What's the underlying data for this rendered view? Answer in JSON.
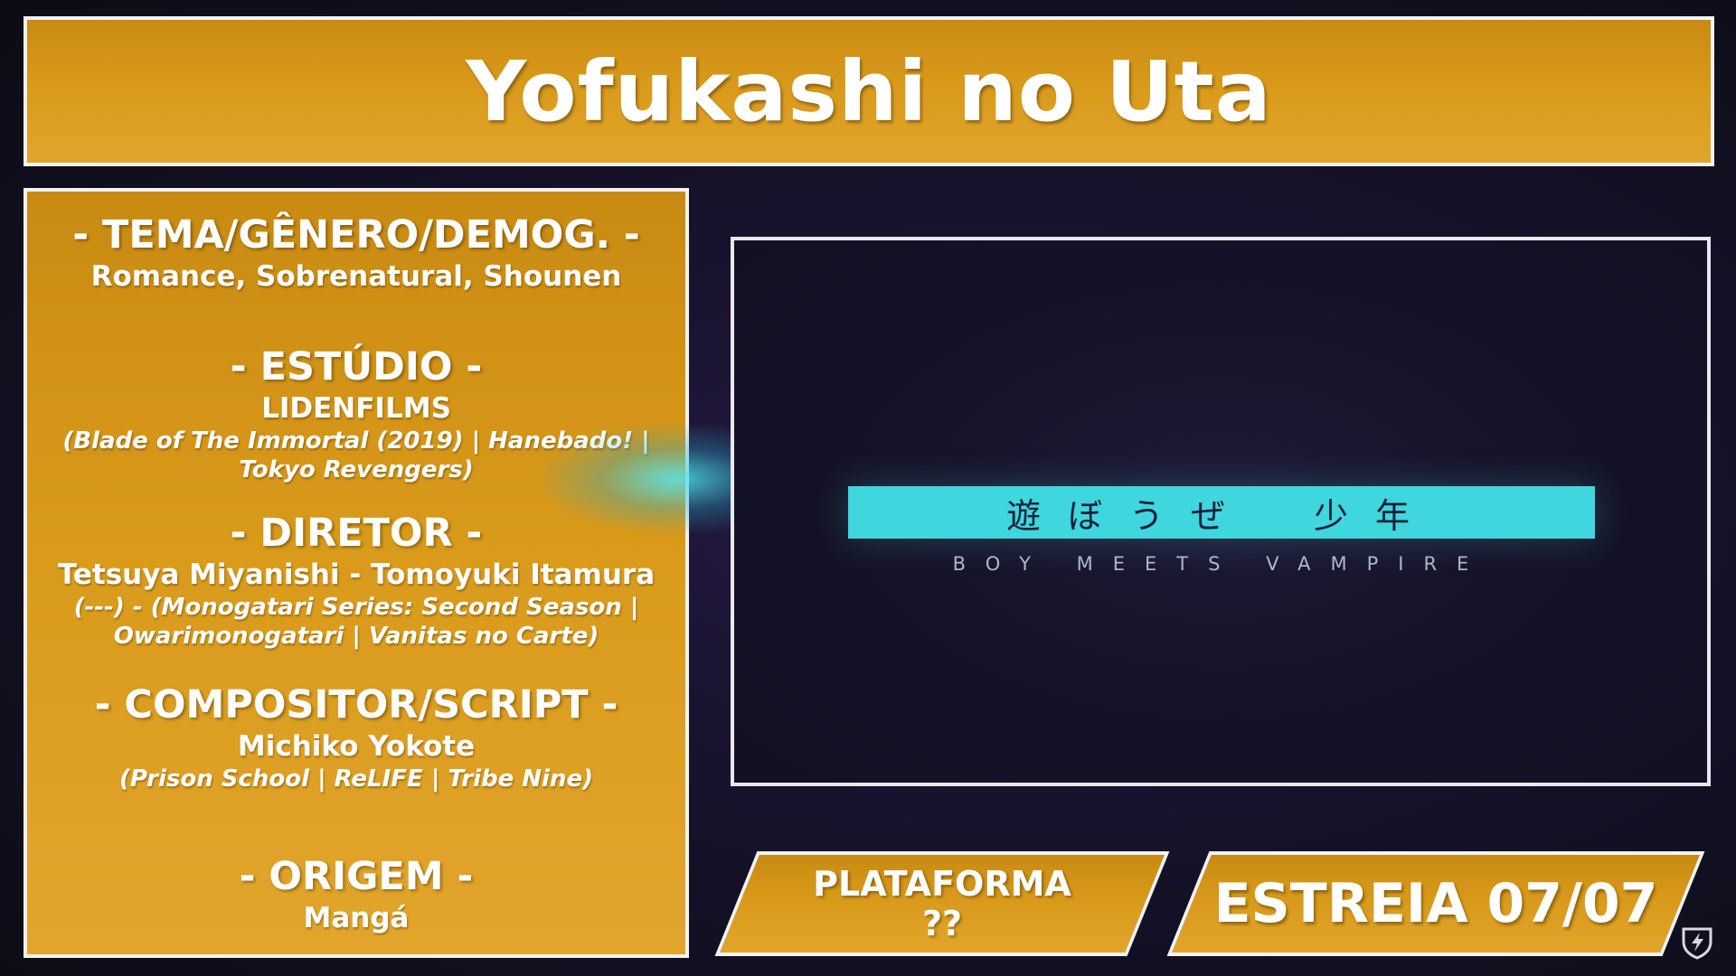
{
  "title": "Yofukashi no Uta",
  "info": {
    "tema": {
      "heading": "- TEMA/GÊNERO/DEMOG. -",
      "value": "Romance, Sobrenatural, Shounen"
    },
    "estudio": {
      "heading": "- ESTÚDIO -",
      "value": "LIDENFILMS",
      "note": "(Blade of The Immortal (2019) | Hanebado! | Tokyo Revengers)"
    },
    "diretor": {
      "heading": "- DIRETOR -",
      "value": "Tetsuya Miyanishi - Tomoyuki Itamura",
      "note": "(---) - (Monogatari Series: Second Season | Owarimonogatari | Vanitas no Carte)"
    },
    "compositor": {
      "heading": "- COMPOSITOR/SCRIPT -",
      "value": "Michiko Yokote",
      "note": "(Prison School | ReLIFE | Tribe Nine)"
    },
    "origem": {
      "heading": "- ORIGEM -",
      "value": "Mangá"
    }
  },
  "video": {
    "bar_text": "遊ぼうぜ　少年",
    "subtitle": "BOY MEETS VAMPIRE"
  },
  "platform": {
    "label": "PLATAFORMA",
    "value": "??"
  },
  "release": {
    "label": "ESTREIA 07/07"
  },
  "colors": {
    "gold": "#d99a1a",
    "cyan": "#3fd6dd",
    "border": "#f2f2f2",
    "background": "#101020"
  },
  "icons": {
    "corner": "shield-bolt-icon"
  }
}
